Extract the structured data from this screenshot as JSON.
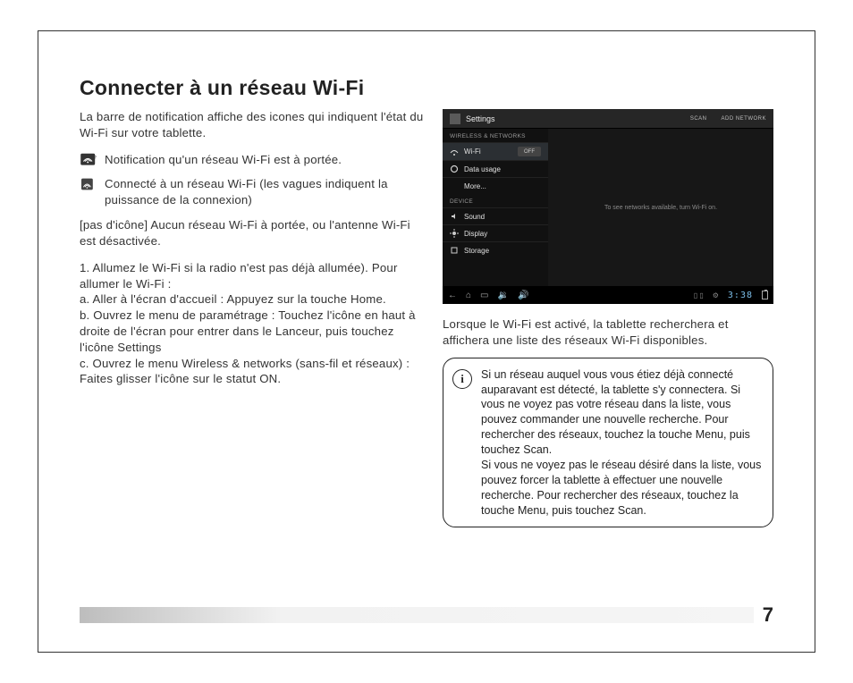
{
  "title": "Connecter à un réseau Wi-Fi",
  "left": {
    "intro": "La barre de notification affiche des icones qui indiquent l'état du Wi-Fi sur votre tablette.",
    "notif_available": "Notification qu'un réseau Wi-Fi est à portée.",
    "notif_connected": "Connecté à un réseau Wi-Fi (les vagues indiquent la puissance de la connexion)",
    "no_icon": "[pas d'icône] Aucun réseau Wi-Fi à portée, ou l'antenne Wi-Fi est désactivée.",
    "step1": "1. Allumez le Wi-Fi si la radio n'est pas déjà allumée). Pour allumer le Wi-Fi :",
    "step_a": "a. Aller à l'écran d'accueil : Appuyez sur la touche Home.",
    "step_b": "b. Ouvrez le menu de paramétrage : Touchez l'icône en haut à droite de l'écran pour entrer dans le Lanceur, puis touchez l'icône Settings",
    "step_c": "c. Ouvrez le menu Wireless & networks (sans-fil et réseaux) : Faites glisser l'icône sur le statut ON."
  },
  "tablet": {
    "app_title": "Settings",
    "scan": "SCAN",
    "add_network": "ADD NETWORK",
    "section_wireless": "WIRELESS & NETWORKS",
    "wifi": "Wi-Fi",
    "wifi_toggle": "OFF",
    "data_usage": "Data usage",
    "more": "More...",
    "section_device": "DEVICE",
    "sound": "Sound",
    "display": "Display",
    "storage": "Storage",
    "main_msg": "To see networks available, turn Wi-Fi on.",
    "clock": "3:38"
  },
  "right": {
    "after_tablet": "Lorsque le Wi-Fi est activé, la tablette recherchera et affichera une liste des réseaux Wi-Fi disponibles.",
    "info_p1": "Si un réseau auquel vous vous étiez déjà connecté auparavant est détecté, la tablette s'y connectera. Si vous ne voyez pas votre réseau dans la liste, vous pouvez commander une nouvelle recherche. Pour rechercher des réseaux, touchez la touche Menu, puis touchez Scan.",
    "info_p2": "Si vous ne voyez pas le réseau désiré dans la liste, vous pouvez forcer la tablette à effectuer une nouvelle recherche. Pour rechercher des réseaux, touchez la touche Menu, puis touchez Scan."
  },
  "page_number": "7"
}
